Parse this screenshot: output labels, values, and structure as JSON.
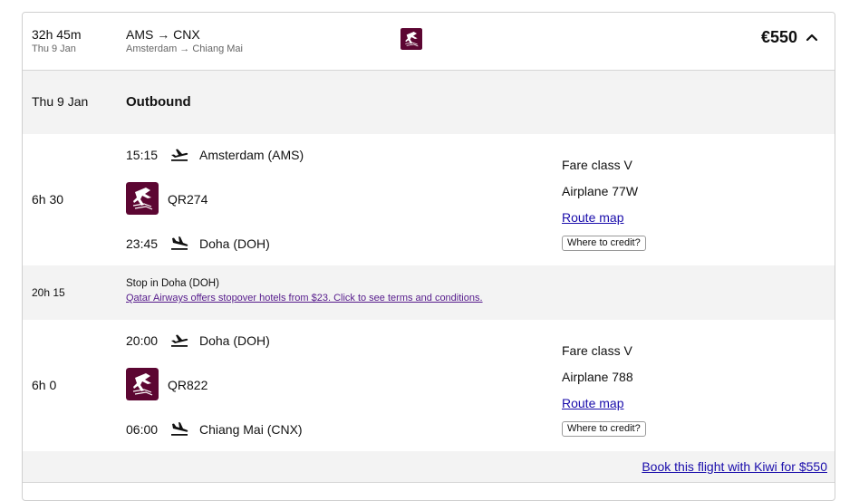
{
  "summary": {
    "duration": "32h 45m",
    "date": "Thu 9 Jan",
    "route": "AMS → CNX",
    "route_full": "Amsterdam → Chiang Mai",
    "price": "€550"
  },
  "outbound": {
    "date": "Thu 9 Jan",
    "title": "Outbound"
  },
  "segments": [
    {
      "duration": "6h 30",
      "dep_time": "15:15",
      "dep_airport": "Amsterdam (AMS)",
      "flight": "QR274",
      "arr_time": "23:45",
      "arr_airport": "Doha (DOH)",
      "fare_class": "Fare class V",
      "airplane": "Airplane 77W",
      "route_map": "Route map",
      "credit": "Where to credit?"
    },
    {
      "duration": "6h 0",
      "dep_time": "20:00",
      "dep_airport": "Doha (DOH)",
      "flight": "QR822",
      "arr_time": "06:00",
      "arr_airport": "Chiang Mai (CNX)",
      "fare_class": "Fare class V",
      "airplane": "Airplane 788",
      "route_map": "Route map",
      "credit": "Where to credit?"
    }
  ],
  "stop": {
    "duration": "20h 15",
    "title": "Stop in Doha (DOH)",
    "link": "Qatar Airways offers stopover hotels from $23. Click to see terms and conditions."
  },
  "book": {
    "label": "Book this flight with Kiwi for $550"
  },
  "colors": {
    "airline_maroon": "#5c0632",
    "link": "#1a0dab",
    "visited_link": "#551a8b",
    "band": "#f3f3f3"
  },
  "icons": [
    "airline-logo-icon",
    "chevron-up-icon",
    "takeoff-icon",
    "landing-icon"
  ]
}
